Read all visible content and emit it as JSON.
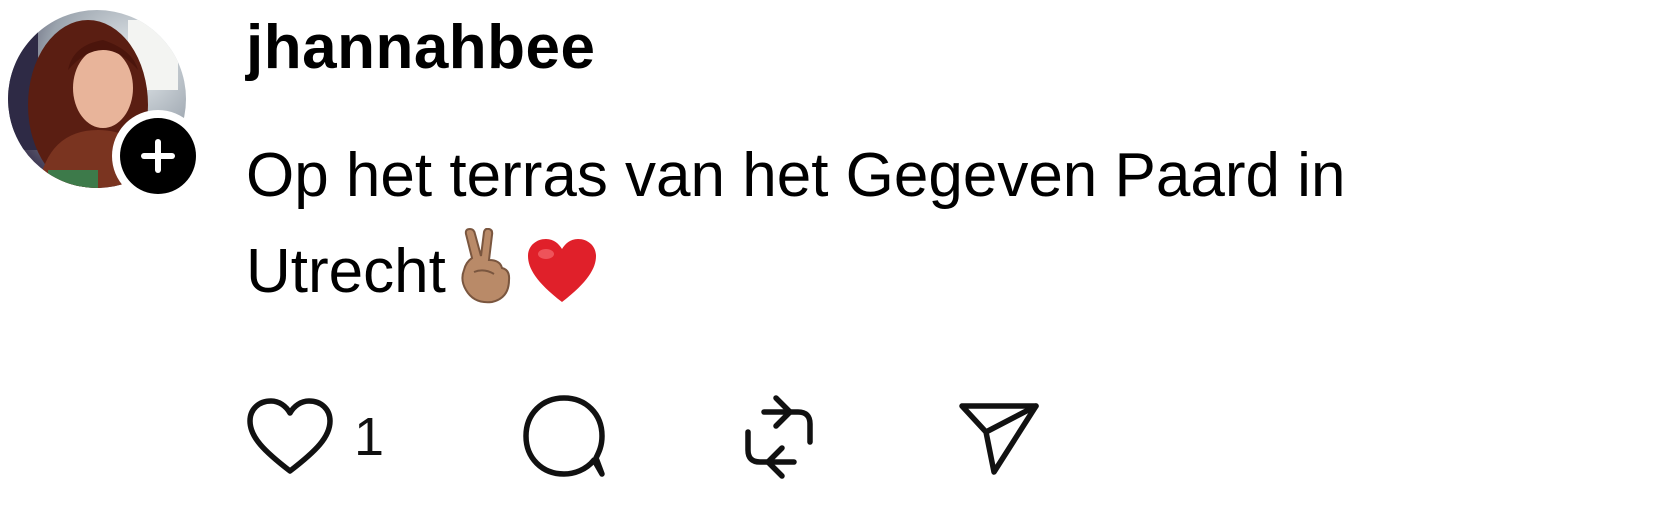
{
  "post": {
    "username": "jhannahbee",
    "text_line1": "Op het terras van het Gegeven Paard in",
    "text_line2": "Utrecht",
    "emojis": [
      "victory-hand-medium-skin",
      "red-heart"
    ],
    "like_count": "1"
  },
  "icons": {
    "follow": "plus-icon",
    "like": "heart-outline-icon",
    "comment": "comment-bubble-icon",
    "repost": "repost-icon",
    "share": "send-icon"
  },
  "colors": {
    "text": "#000000",
    "heart_emoji": "#e0202a",
    "skin_tone": "#b98a68"
  }
}
